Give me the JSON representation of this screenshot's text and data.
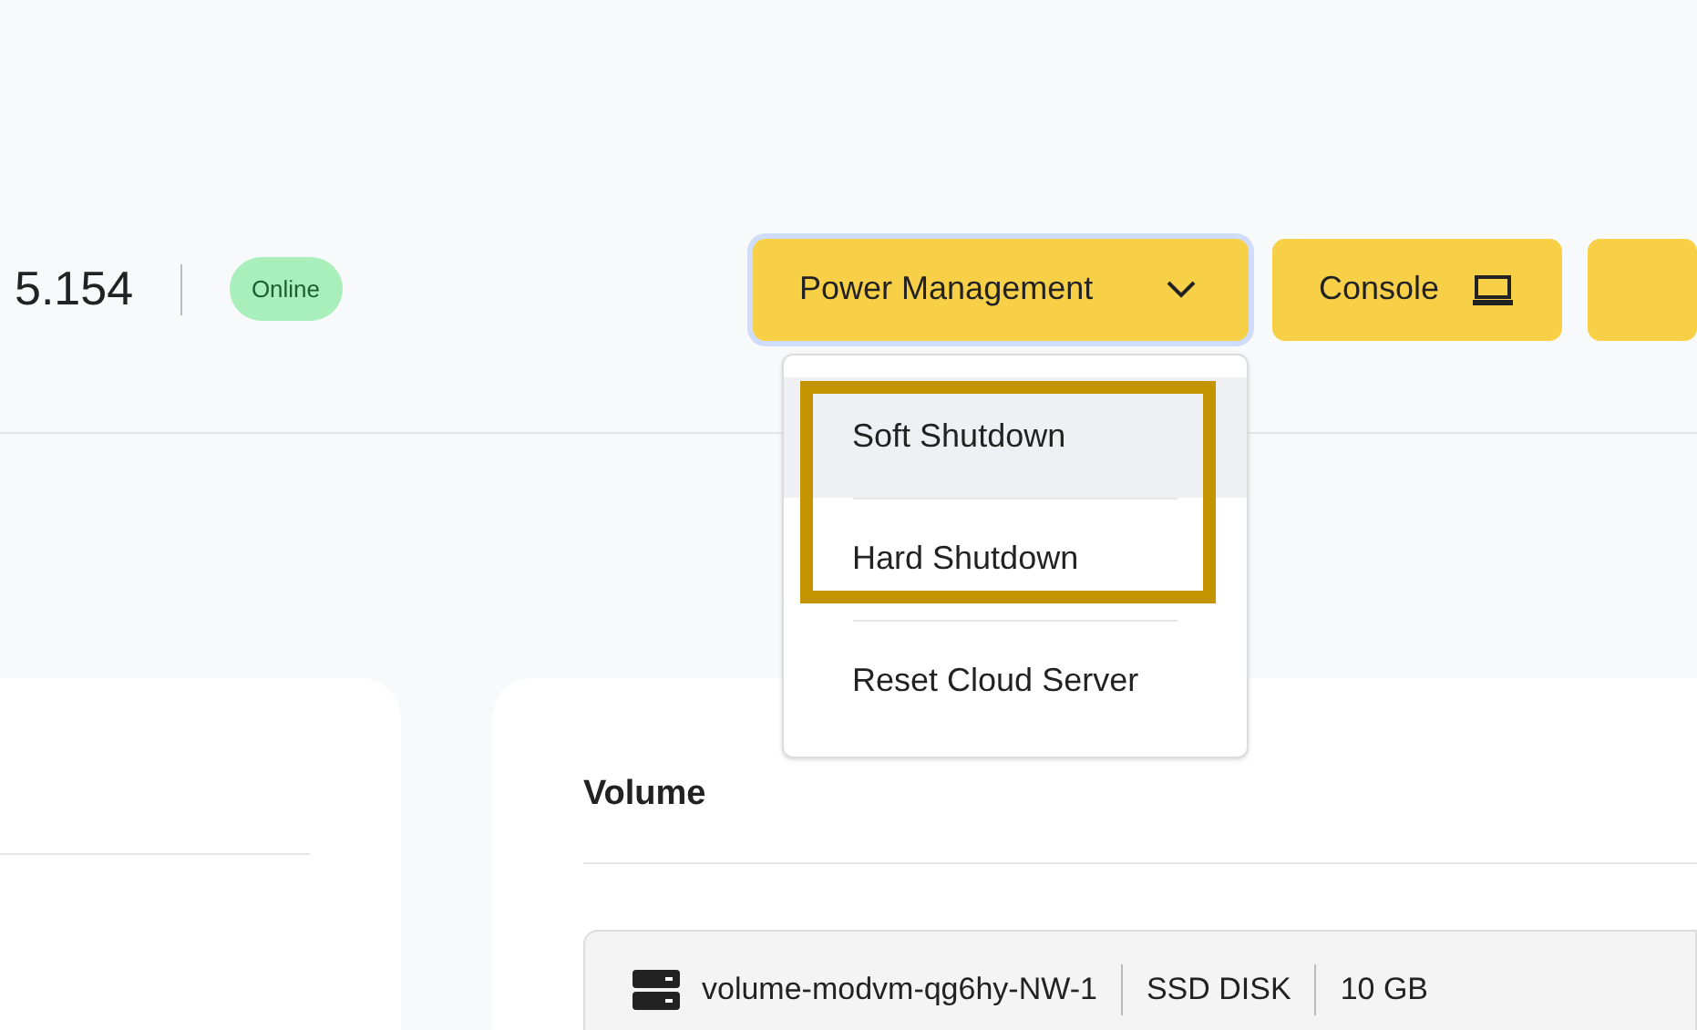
{
  "header": {
    "server_ip_fragment": "5.154",
    "status": "Online"
  },
  "actions": {
    "power_button": {
      "label": "Power Management",
      "expanded": true
    },
    "console_button": {
      "label": "Console"
    }
  },
  "power_menu": [
    {
      "label": "Soft Shutdown",
      "selected": true,
      "highlighted": true
    },
    {
      "label": "Hard Shutdown",
      "selected": false,
      "highlighted": true
    },
    {
      "label": "Reset Cloud Server",
      "selected": false,
      "highlighted": false
    }
  ],
  "volume_card": {
    "title": "Volume",
    "volumes": [
      {
        "name": "volume-modvm-qg6hy-NW-1",
        "type": "SSD DISK",
        "size": "10 GB"
      }
    ]
  }
}
